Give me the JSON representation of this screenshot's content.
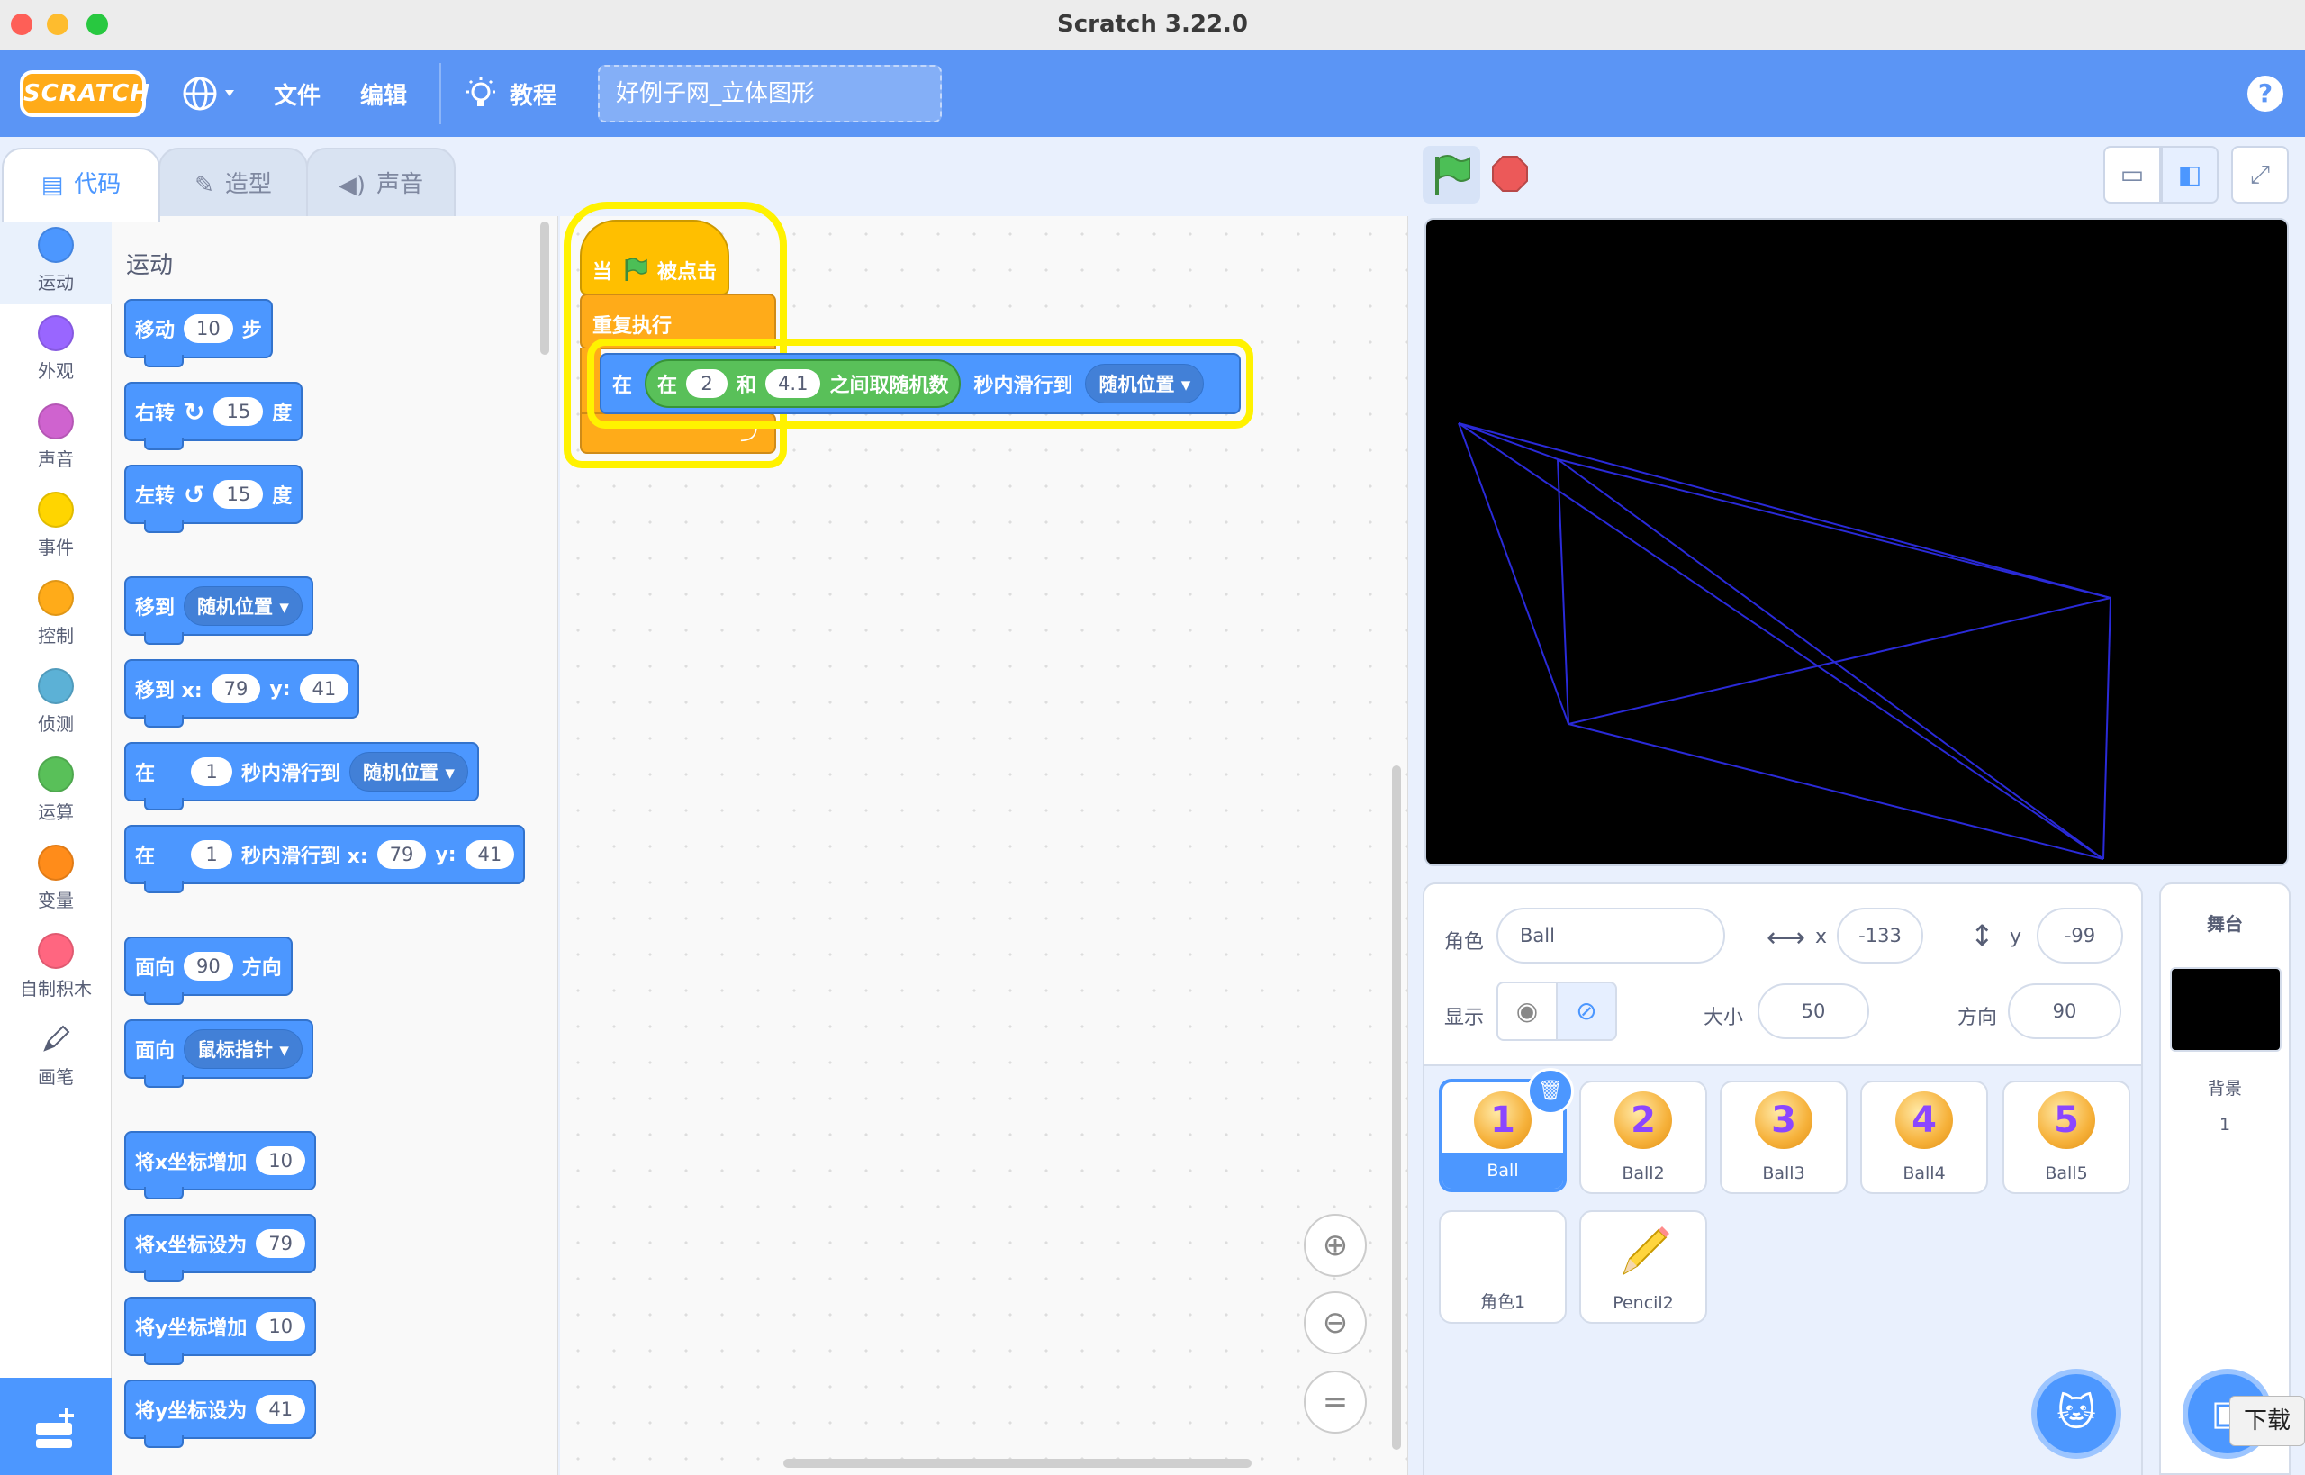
{
  "window": {
    "title": "Scratch 3.22.0"
  },
  "menubar": {
    "logo": "SCRATCH",
    "file": "文件",
    "edit": "编辑",
    "tutorials": "教程",
    "project_title": "好例子网_立体图形",
    "help": "?"
  },
  "tabs": [
    {
      "label": "代码",
      "icon": "code-icon"
    },
    {
      "label": "造型",
      "icon": "brush-icon"
    },
    {
      "label": "声音",
      "icon": "speaker-icon"
    }
  ],
  "categories": [
    {
      "label": "运动",
      "color": "#4c97ff"
    },
    {
      "label": "外观",
      "color": "#9966ff"
    },
    {
      "label": "声音",
      "color": "#cf63cf"
    },
    {
      "label": "事件",
      "color": "#ffd500"
    },
    {
      "label": "控制",
      "color": "#ffab19"
    },
    {
      "label": "侦测",
      "color": "#5cb1d6"
    },
    {
      "label": "运算",
      "color": "#59c059"
    },
    {
      "label": "变量",
      "color": "#ff8c1a"
    },
    {
      "label": "自制积木",
      "color": "#ff6680"
    },
    {
      "label": "画笔",
      "color": "#0fbd8c"
    }
  ],
  "palette": {
    "title": "运动",
    "move": {
      "pre": "移动",
      "val": "10",
      "post": "步"
    },
    "turn_right": {
      "pre": "右转",
      "val": "15",
      "post": "度"
    },
    "turn_left": {
      "pre": "左转",
      "val": "15",
      "post": "度"
    },
    "goto": {
      "pre": "移到",
      "dd": "随机位置"
    },
    "goto_xy": {
      "pre": "移到 x:",
      "x": "79",
      "ylabel": "y:",
      "y": "41"
    },
    "glide_to": {
      "pre": "在",
      "val": "1",
      "mid": "秒内滑行到",
      "dd": "随机位置"
    },
    "glide_xy": {
      "pre": "在",
      "val": "1",
      "mid": "秒内滑行到 x:",
      "x": "79",
      "ylabel": "y:",
      "y": "41"
    },
    "point_dir": {
      "pre": "面向",
      "val": "90",
      "post": "方向"
    },
    "point_towards": {
      "pre": "面向",
      "dd": "鼠标指针"
    },
    "change_x": {
      "pre": "将x坐标增加",
      "val": "10"
    },
    "set_x": {
      "pre": "将x坐标设为",
      "val": "79"
    },
    "change_y": {
      "pre": "将y坐标增加",
      "val": "10"
    },
    "set_y": {
      "pre": "将y坐标设为",
      "val": "41"
    }
  },
  "script": {
    "hat_pre": "当",
    "hat_post": "被点击",
    "forever": "重复执行",
    "glide_pre": "在",
    "random_pre": "在",
    "random_a": "2",
    "random_and": "和",
    "random_b": "4.1",
    "random_post": "之间取随机数",
    "glide_mid": "秒内滑行到",
    "glide_dd": "随机位置"
  },
  "sprite_info": {
    "sprite_label": "角色",
    "sprite_name": "Ball",
    "x_label": "x",
    "x": "-133",
    "y_label": "y",
    "y": "-99",
    "show_label": "显示",
    "size_label": "大小",
    "size": "50",
    "direction_label": "方向",
    "direction": "90"
  },
  "sprites": [
    {
      "name": "Ball",
      "num": "1",
      "selected": true
    },
    {
      "name": "Ball2",
      "num": "2"
    },
    {
      "name": "Ball3",
      "num": "3"
    },
    {
      "name": "Ball4",
      "num": "4"
    },
    {
      "name": "Ball5",
      "num": "5"
    },
    {
      "name": "角色1",
      "num": ""
    },
    {
      "name": "Pencil2",
      "num": ""
    }
  ],
  "stage_panel": {
    "title": "舞台",
    "backdrop_label": "背景",
    "backdrop_count": "1"
  },
  "tooltip": "下载",
  "colors": {
    "accent": "#4c97ff",
    "menubar": "#5b95f5",
    "stage_line": "#2a2ad8"
  }
}
